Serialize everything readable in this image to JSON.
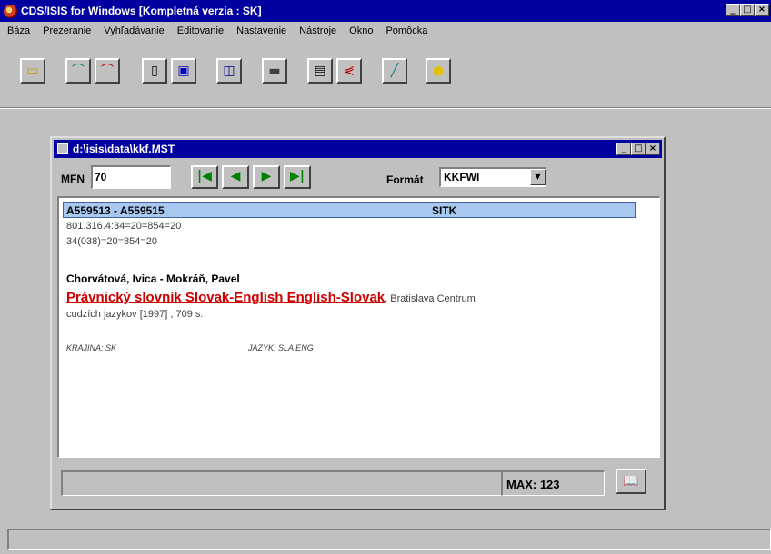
{
  "window": {
    "title": "CDS/ISIS for Windows [Kompletná verzia : SK]",
    "buttons": [
      "_",
      "□",
      "×"
    ]
  },
  "menu": [
    "Báza",
    "Prezeranie",
    "Vyhľadávanie",
    "Editovanie",
    "Nastavenie",
    "Nástroje",
    "Okno",
    "Pomôcka"
  ],
  "toolbar": [
    {
      "icon": "open-folder-icon",
      "glyph": "▭"
    },
    {
      "icon": "search-icon",
      "glyph": "⌒"
    },
    {
      "icon": "search-advanced-icon",
      "glyph": "⌒"
    },
    {
      "icon": "document-icon",
      "glyph": "▯"
    },
    {
      "icon": "copy-records-icon",
      "glyph": "▣"
    },
    {
      "icon": "print-preview-icon",
      "glyph": "◫"
    },
    {
      "icon": "print-icon",
      "glyph": "▬"
    },
    {
      "icon": "form-icon",
      "glyph": "▤"
    },
    {
      "icon": "graph-icon",
      "glyph": "⋞"
    },
    {
      "icon": "edit-pen-icon",
      "glyph": "╱"
    },
    {
      "icon": "lightbulb-icon",
      "glyph": "💡"
    }
  ],
  "child_window": {
    "title": "d:\\isis\\data\\kkf.MST",
    "buttons": [
      "_",
      "□",
      "×"
    ],
    "mfn_label": "MFN",
    "mfn_value": "70",
    "nav_buttons": [
      "|◀",
      "◀",
      "▶",
      "▶|"
    ],
    "format_label": "Formát",
    "format_value": "KKFWI"
  },
  "record": {
    "id_range": "A559513 - A559515",
    "signature": "SITK",
    "class1": "801.316.4:34=20=854=20",
    "class2": "34(038)=20=854=20",
    "authors": "Chorvátová, Ivica - Mokráň, Pavel",
    "title": "Právnický slovník Slovak-English English-Slovak",
    "publisher_part1": ", Bratislava Centrum",
    "publisher_part2": "cudzích jazykov [1997] , 709 s.",
    "country": "KRAJINA: SK",
    "language": "JAZYK: SLA ENG"
  },
  "status": {
    "max_text": "MAX: 123",
    "book_icon": "book-icon"
  }
}
